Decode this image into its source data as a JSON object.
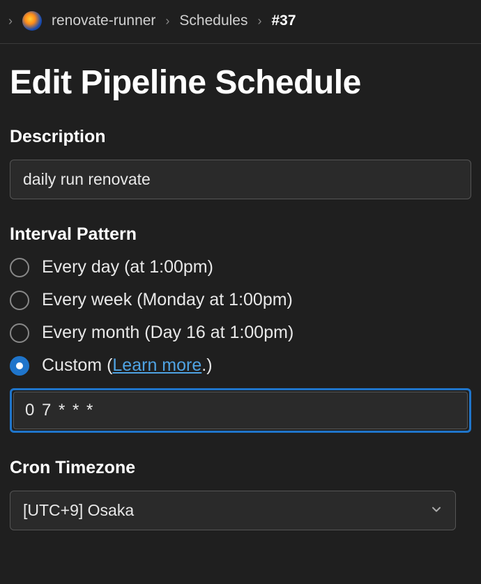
{
  "breadcrumb": {
    "project": "renovate-runner",
    "section": "Schedules",
    "current": "#37"
  },
  "page": {
    "title": "Edit Pipeline Schedule"
  },
  "description": {
    "label": "Description",
    "value": "daily run renovate"
  },
  "interval": {
    "label": "Interval Pattern",
    "options": [
      {
        "label": "Every day (at 1:00pm)",
        "selected": false
      },
      {
        "label": "Every week (Monday at 1:00pm)",
        "selected": false
      },
      {
        "label": "Every month (Day 16 at 1:00pm)",
        "selected": false
      }
    ],
    "custom_prefix": "Custom (",
    "custom_link": "Learn more",
    "custom_suffix": ".)",
    "cron_value": "0 7 * * *"
  },
  "timezone": {
    "label": "Cron Timezone",
    "value": "[UTC+9] Osaka"
  }
}
